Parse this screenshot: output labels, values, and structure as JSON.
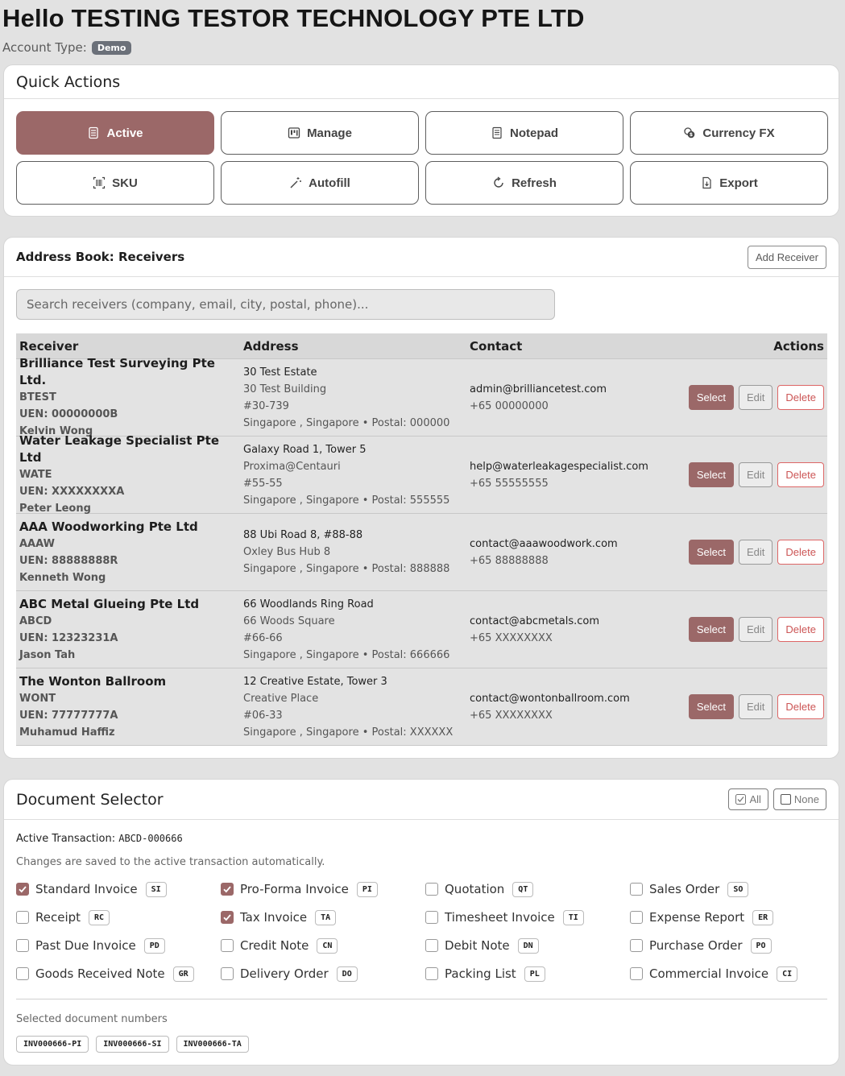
{
  "header": {
    "greeting": "Hello TESTING TESTOR TECHNOLOGY PTE LTD",
    "account_type_label": "Account Type:",
    "account_type_value": "Demo"
  },
  "quick_actions": {
    "title": "Quick Actions",
    "buttons": [
      {
        "label": "Active",
        "icon": "calculator-icon",
        "active": true
      },
      {
        "label": "Manage",
        "icon": "kanban-icon",
        "active": false
      },
      {
        "label": "Notepad",
        "icon": "notepad-icon",
        "active": false
      },
      {
        "label": "Currency FX",
        "icon": "coins-icon",
        "active": false
      },
      {
        "label": "SKU",
        "icon": "barcode-icon",
        "active": false
      },
      {
        "label": "Autofill",
        "icon": "magic-wand-icon",
        "active": false
      },
      {
        "label": "Refresh",
        "icon": "refresh-icon",
        "active": false
      },
      {
        "label": "Export",
        "icon": "export-file-icon",
        "active": false
      }
    ]
  },
  "address_book": {
    "title": "Address Book: Receivers",
    "add_button": "Add Receiver",
    "search_placeholder": "Search receivers (company, email, city, postal, phone)...",
    "columns": [
      "Receiver",
      "Address",
      "Contact",
      "Actions"
    ],
    "action_labels": {
      "select": "Select",
      "edit": "Edit",
      "delete": "Delete"
    },
    "rows": [
      {
        "name": "Brilliance Test Surveying Pte Ltd.",
        "code": "BTEST",
        "uen": "UEN: 00000000B",
        "person": "Kelvin Wong",
        "address": [
          "30 Test Estate",
          "30 Test Building",
          "#30-739",
          "Singapore , Singapore • Postal: 000000"
        ],
        "email": "admin@brilliancetest.com",
        "phone": "+65 00000000"
      },
      {
        "name": "Water Leakage Specialist Pte Ltd",
        "code": "WATE",
        "uen": "UEN: XXXXXXXXA",
        "person": "Peter Leong",
        "address": [
          "Galaxy Road 1, Tower 5",
          "Proxima@Centauri",
          "#55-55",
          "Singapore , Singapore • Postal: 555555"
        ],
        "email": "help@waterleakagespecialist.com",
        "phone": "+65 55555555"
      },
      {
        "name": "AAA Woodworking Pte Ltd",
        "code": "AAAW",
        "uen": "UEN: 88888888R",
        "person": "Kenneth Wong",
        "address": [
          "88 Ubi Road 8, #88-88",
          "Oxley Bus Hub 8",
          "Singapore , Singapore • Postal: 888888"
        ],
        "email": "contact@aaawoodwork.com",
        "phone": "+65 88888888"
      },
      {
        "name": "ABC Metal Glueing Pte Ltd",
        "code": "ABCD",
        "uen": "UEN: 12323231A",
        "person": "Jason Tah",
        "address": [
          "66 Woodlands Ring Road",
          "66 Woods Square",
          "#66-66",
          "Singapore , Singapore • Postal: 666666"
        ],
        "email": "contact@abcmetals.com",
        "phone": "+65 XXXXXXXX"
      },
      {
        "name": "The Wonton Ballroom",
        "code": "WONT",
        "uen": "UEN: 77777777A",
        "person": "Muhamud Haffiz",
        "address": [
          "12 Creative Estate, Tower 3",
          "Creative Place",
          "#06-33",
          "Singapore , Singapore • Postal: XXXXXX"
        ],
        "email": "contact@wontonballroom.com",
        "phone": "+65 XXXXXXXX"
      }
    ]
  },
  "document_selector": {
    "title": "Document Selector",
    "all_button": "All",
    "none_button": "None",
    "active_label": "Active Transaction:",
    "active_value": "ABCD-000666",
    "note": "Changes are saved to the active transaction automatically.",
    "documents": [
      {
        "label": "Standard Invoice",
        "code": "SI",
        "checked": true
      },
      {
        "label": "Pro-Forma Invoice",
        "code": "PI",
        "checked": true
      },
      {
        "label": "Quotation",
        "code": "QT",
        "checked": false
      },
      {
        "label": "Sales Order",
        "code": "SO",
        "checked": false
      },
      {
        "label": "Receipt",
        "code": "RC",
        "checked": false
      },
      {
        "label": "Tax Invoice",
        "code": "TA",
        "checked": true
      },
      {
        "label": "Timesheet Invoice",
        "code": "TI",
        "checked": false
      },
      {
        "label": "Expense Report",
        "code": "ER",
        "checked": false
      },
      {
        "label": "Past Due Invoice",
        "code": "PD",
        "checked": false
      },
      {
        "label": "Credit Note",
        "code": "CN",
        "checked": false
      },
      {
        "label": "Debit Note",
        "code": "DN",
        "checked": false
      },
      {
        "label": "Purchase Order",
        "code": "PO",
        "checked": false
      },
      {
        "label": "Goods Received Note",
        "code": "GR",
        "checked": false
      },
      {
        "label": "Delivery Order",
        "code": "DO",
        "checked": false
      },
      {
        "label": "Packing List",
        "code": "PL",
        "checked": false
      },
      {
        "label": "Commercial Invoice",
        "code": "CI",
        "checked": false
      }
    ],
    "selected_label": "Selected document numbers",
    "selected_numbers": [
      "INV000666-PI",
      "INV000666-SI",
      "INV000666-TA"
    ]
  },
  "colors": {
    "accent": "#9b6868",
    "danger": "#cc5555",
    "page_bg": "#e2e2e2"
  }
}
